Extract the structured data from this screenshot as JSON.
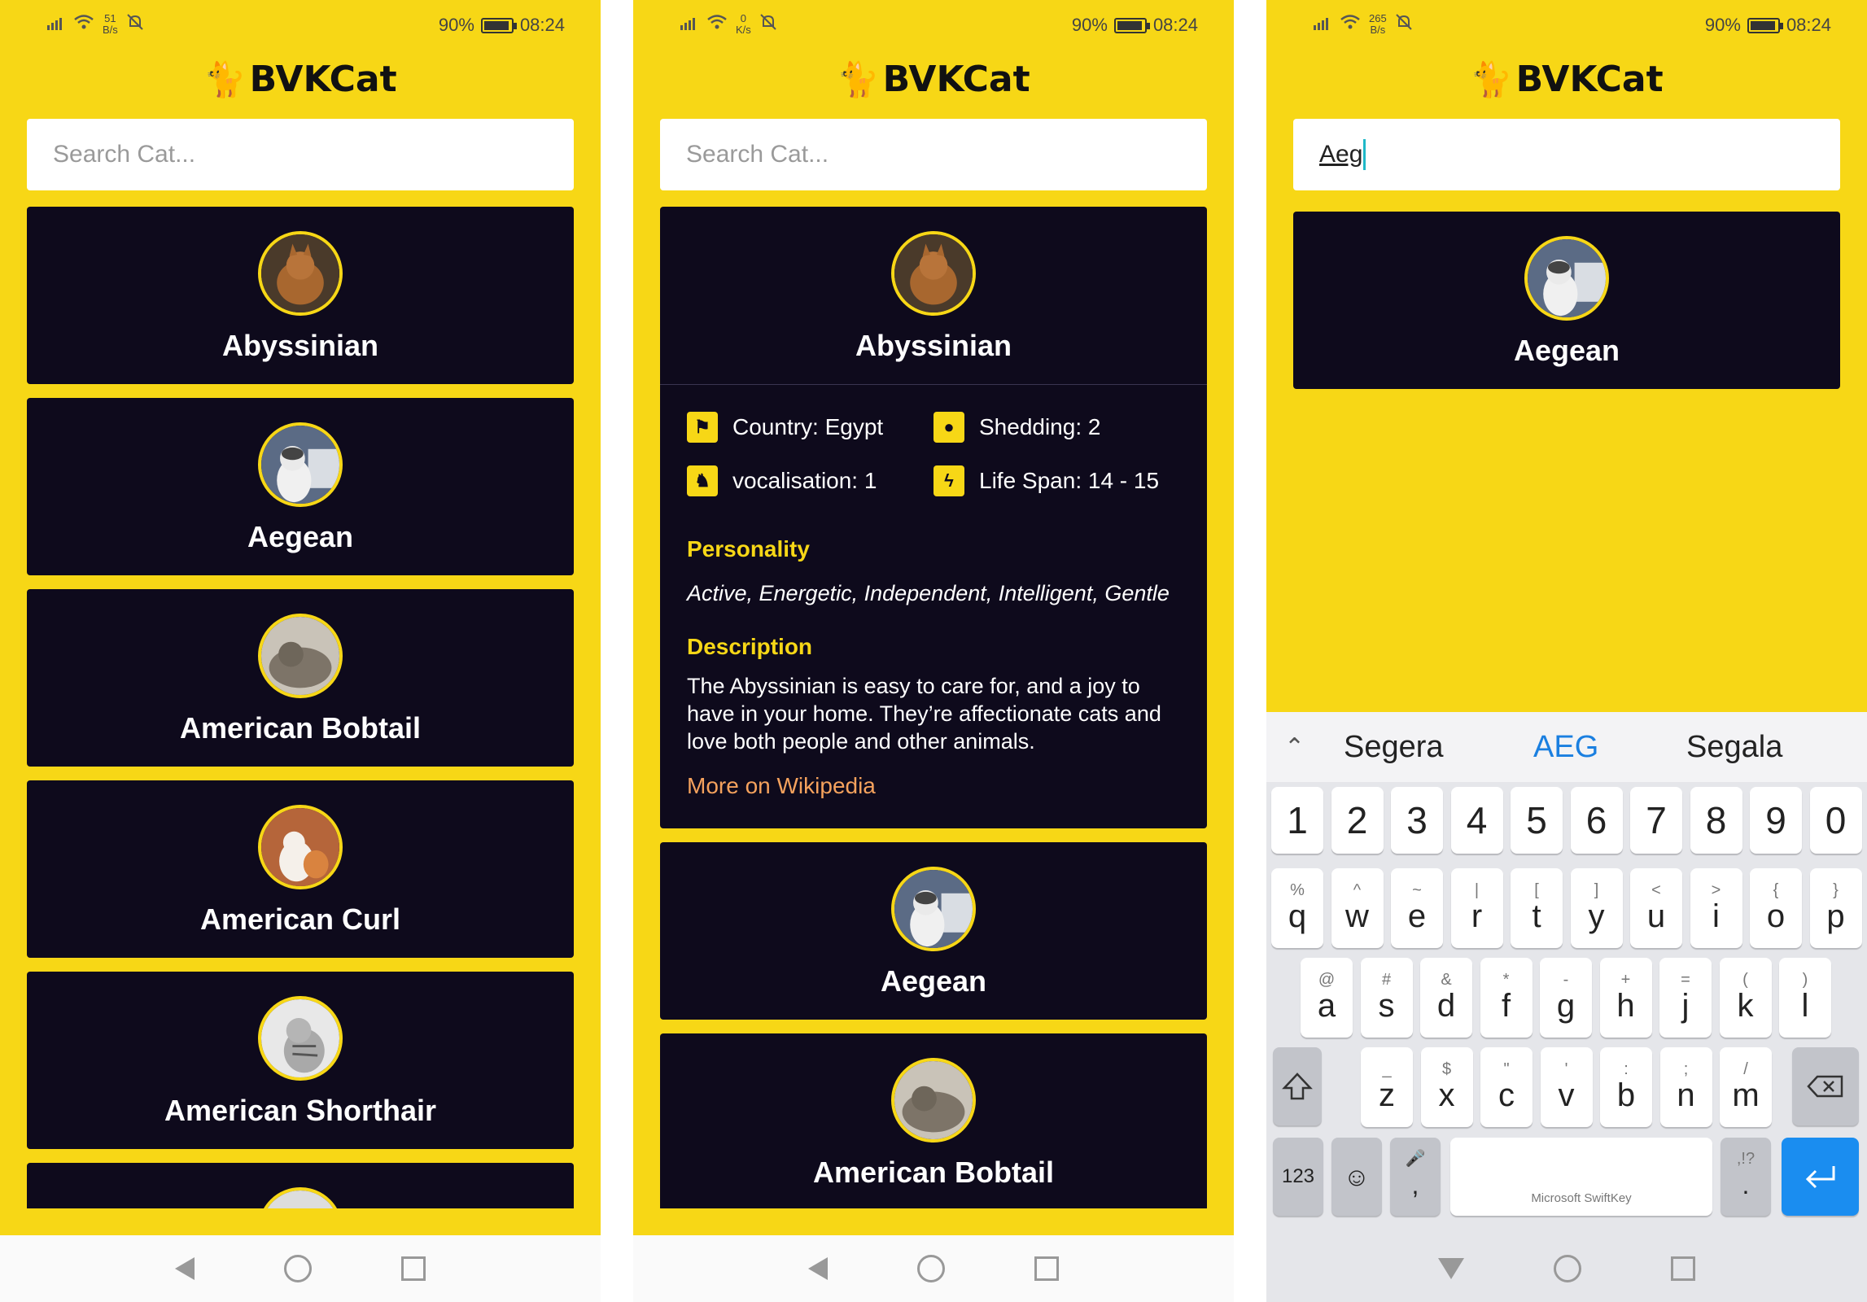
{
  "app": {
    "logo_text": "BVKCat"
  },
  "screens": [
    {
      "status": {
        "speed_top": "51",
        "speed_bottom": "B/s",
        "battery": "90%",
        "time": "08:24"
      },
      "search": {
        "placeholder": "Search Cat...",
        "value": ""
      },
      "cards": [
        {
          "name": "Abyssinian",
          "color": "#8a5a2b"
        },
        {
          "name": "Aegean",
          "color": "#5b6b85"
        },
        {
          "name": "American Bobtail",
          "color": "#7d7468"
        },
        {
          "name": "American Curl",
          "color": "#b5653a"
        },
        {
          "name": "American Shorthair",
          "color": "#a9a9a9"
        }
      ]
    },
    {
      "status": {
        "speed_top": "0",
        "speed_bottom": "K/s",
        "battery": "90%",
        "time": "08:24"
      },
      "search": {
        "placeholder": "Search Cat...",
        "value": ""
      },
      "expanded": {
        "name": "Abyssinian",
        "country": "Country: Egypt",
        "shedding": "Shedding: 2",
        "vocalisation": "vocalisation: 1",
        "life_span": "Life Span: 14 - 15",
        "personality_title": "Personality",
        "personality": "Active, Energetic, Independent, Intelligent, Gentle",
        "description_title": "Description",
        "description": "The Abyssinian is easy to care for, and a joy to have in your home. They’re affectionate cats and love both people and other animals.",
        "wiki_link": "More on Wikipedia"
      },
      "cards": [
        {
          "name": "Aegean"
        },
        {
          "name": "American Bobtail"
        }
      ]
    },
    {
      "status": {
        "speed_top": "265",
        "speed_bottom": "B/s",
        "battery": "90%",
        "time": "08:24"
      },
      "search": {
        "placeholder": "Search Cat...",
        "value": "Aeg"
      },
      "cards": [
        {
          "name": "Aegean"
        }
      ],
      "keyboard": {
        "suggestions": [
          "Segera",
          "AEG",
          "Segala"
        ],
        "numbers": [
          "1",
          "2",
          "3",
          "4",
          "5",
          "6",
          "7",
          "8",
          "9",
          "0"
        ],
        "row1": [
          {
            "h": "%",
            "c": "q"
          },
          {
            "h": "^",
            "c": "w"
          },
          {
            "h": "~",
            "c": "e"
          },
          {
            "h": "|",
            "c": "r"
          },
          {
            "h": "[",
            "c": "t"
          },
          {
            "h": "]",
            "c": "y"
          },
          {
            "h": "<",
            "c": "u"
          },
          {
            "h": ">",
            "c": "i"
          },
          {
            "h": "{",
            "c": "o"
          },
          {
            "h": "}",
            "c": "p"
          }
        ],
        "row2": [
          {
            "h": "@",
            "c": "a"
          },
          {
            "h": "#",
            "c": "s"
          },
          {
            "h": "&",
            "c": "d"
          },
          {
            "h": "*",
            "c": "f"
          },
          {
            "h": "-",
            "c": "g"
          },
          {
            "h": "+",
            "c": "h"
          },
          {
            "h": "=",
            "c": "j"
          },
          {
            "h": "(",
            "c": "k"
          },
          {
            "h": ")",
            "c": "l"
          }
        ],
        "row3": [
          {
            "h": "_",
            "c": "z"
          },
          {
            "h": "$",
            "c": "x"
          },
          {
            "h": "\"",
            "c": "c"
          },
          {
            "h": "'",
            "c": "v"
          },
          {
            "h": ":",
            "c": "b"
          },
          {
            "h": ";",
            "c": "n"
          },
          {
            "h": "/",
            "c": "m"
          }
        ],
        "num_key": "123",
        "space_label": "Microsoft SwiftKey",
        "comma": ",",
        "period": ".",
        "period_hint": ",!?"
      }
    }
  ]
}
